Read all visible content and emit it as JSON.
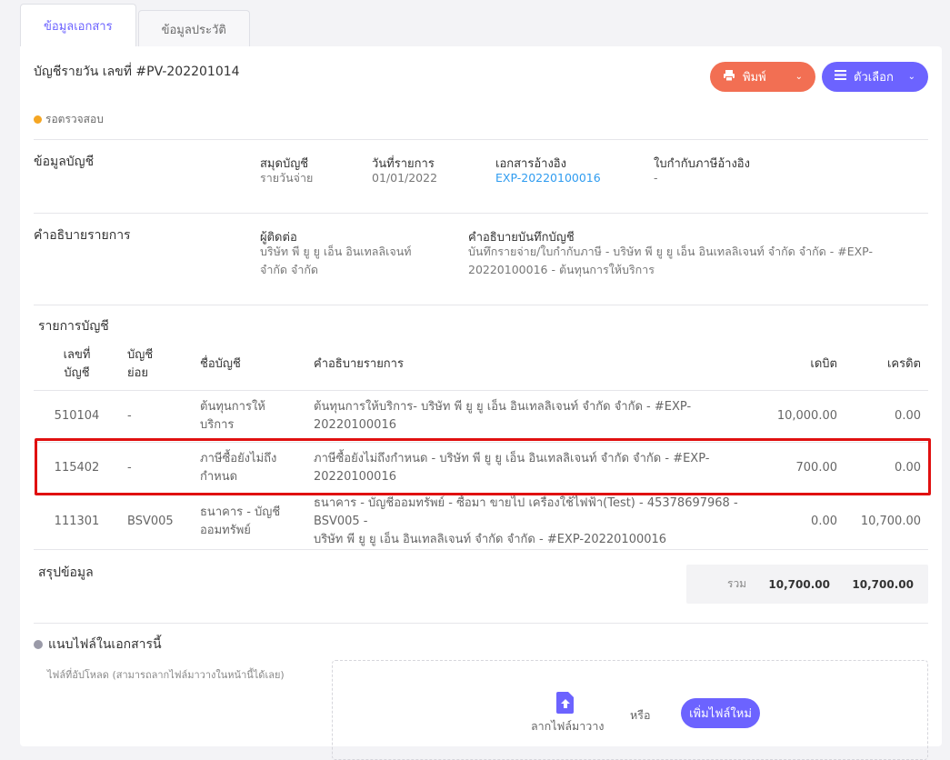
{
  "tabs": [
    "ข้อมูลเอกสาร",
    "ข้อมูลประวัติ"
  ],
  "doc_title": "บัญชีรายวัน เลขที่ #PV-202201014",
  "buttons": {
    "print": "พิมพ์",
    "options": "ตัวเลือก"
  },
  "status": "รอตรวจสอบ",
  "account_info": {
    "heading": "ข้อมูลบัญชี",
    "ledger_label": "สมุดบัญชี",
    "ledger_value": "รายวันจ่าย",
    "date_label": "วันที่รายการ",
    "date_value": "01/01/2022",
    "ref_label": "เอกสารอ้างอิง",
    "ref_value": "EXP-20220100016",
    "tax_label": "ใบกำกับภาษีอ้างอิง",
    "tax_value": "-"
  },
  "description": {
    "heading": "คำอธิบายรายการ",
    "contact_label": "ผู้ติดต่อ",
    "contact_line1": "บริษัท พี ยู ยู เอ็น อินเทลลิเจนท์",
    "contact_line2": "จำกัด จำกัด",
    "note_label": "คำอธิบายบันทึกบัญชี",
    "note_line1": "บันทึกรายจ่าย/ใบกำกับภาษี - บริษัท พี ยู ยู เอ็น อินเทลลิเจนท์ จำกัด จำกัด - #EXP-",
    "note_line2": "20220100016 - ต้นทุนการให้บริการ"
  },
  "ledger": {
    "heading": "รายการบัญชี",
    "headers": {
      "no_1": "เลขที่",
      "no_2": "บัญชี",
      "sub_1": "บัญชี",
      "sub_2": "ย่อย",
      "name": "ชื่อบัญชี",
      "desc": "คำอธิบายรายการ",
      "debit": "เดบิต",
      "credit": "เครดิต"
    },
    "rows": [
      {
        "no": "510104",
        "sub": "-",
        "name_1": "ต้นทุนการให้",
        "name_2": "บริการ",
        "desc_1": "ต้นทุนการให้บริการ- บริษัท พี ยู ยู เอ็น อินเทลลิเจนท์ จำกัด จำกัด - #EXP-20220100016",
        "desc_2": "",
        "debit": "10,000.00",
        "credit": "0.00"
      },
      {
        "no": "115402",
        "sub": "-",
        "name_1": "ภาษีซื้อยังไม่ถึง",
        "name_2": "กำหนด",
        "desc_1": "ภาษีซื้อยังไม่ถึงกำหนด - บริษัท พี ยู ยู เอ็น อินเทลลิเจนท์ จำกัด จำกัด - #EXP-",
        "desc_2": "20220100016",
        "debit": "700.00",
        "credit": "0.00"
      },
      {
        "no": "111301",
        "sub": "BSV005",
        "name_1": "ธนาคาร - บัญชี",
        "name_2": "ออมทรัพย์",
        "desc_1": "ธนาคาร - บัญชีออมทรัพย์ - ซื้อมา ขายไป เครื่องใช้ไฟฟ้า(Test) - 45378697968 - BSV005 -",
        "desc_2": "บริษัท พี ยู ยู เอ็น อินเทลลิเจนท์ จำกัด จำกัด - #EXP-20220100016",
        "debit": "0.00",
        "credit": "10,700.00"
      }
    ]
  },
  "summary": {
    "heading": "สรุปข้อมูล",
    "total_label": "รวม",
    "debit_total": "10,700.00",
    "credit_total": "10,700.00"
  },
  "attachments": {
    "heading": "แนบไฟล์ในเอกสารนี้",
    "hint": "ไฟล์ที่อัปโหลด (สามารถลากไฟล์มาวางในหน้านี้ได้เลย)",
    "drag_text": "ลากไฟล์มาวาง",
    "or_text": "หรือ",
    "add_button": "เพิ่มไฟล์ใหม่"
  },
  "colors": {
    "accent": "#6c63ff",
    "print": "#f26f53",
    "status": "#f5a623",
    "link": "#2f9cf0",
    "highlight": "#e01010"
  }
}
